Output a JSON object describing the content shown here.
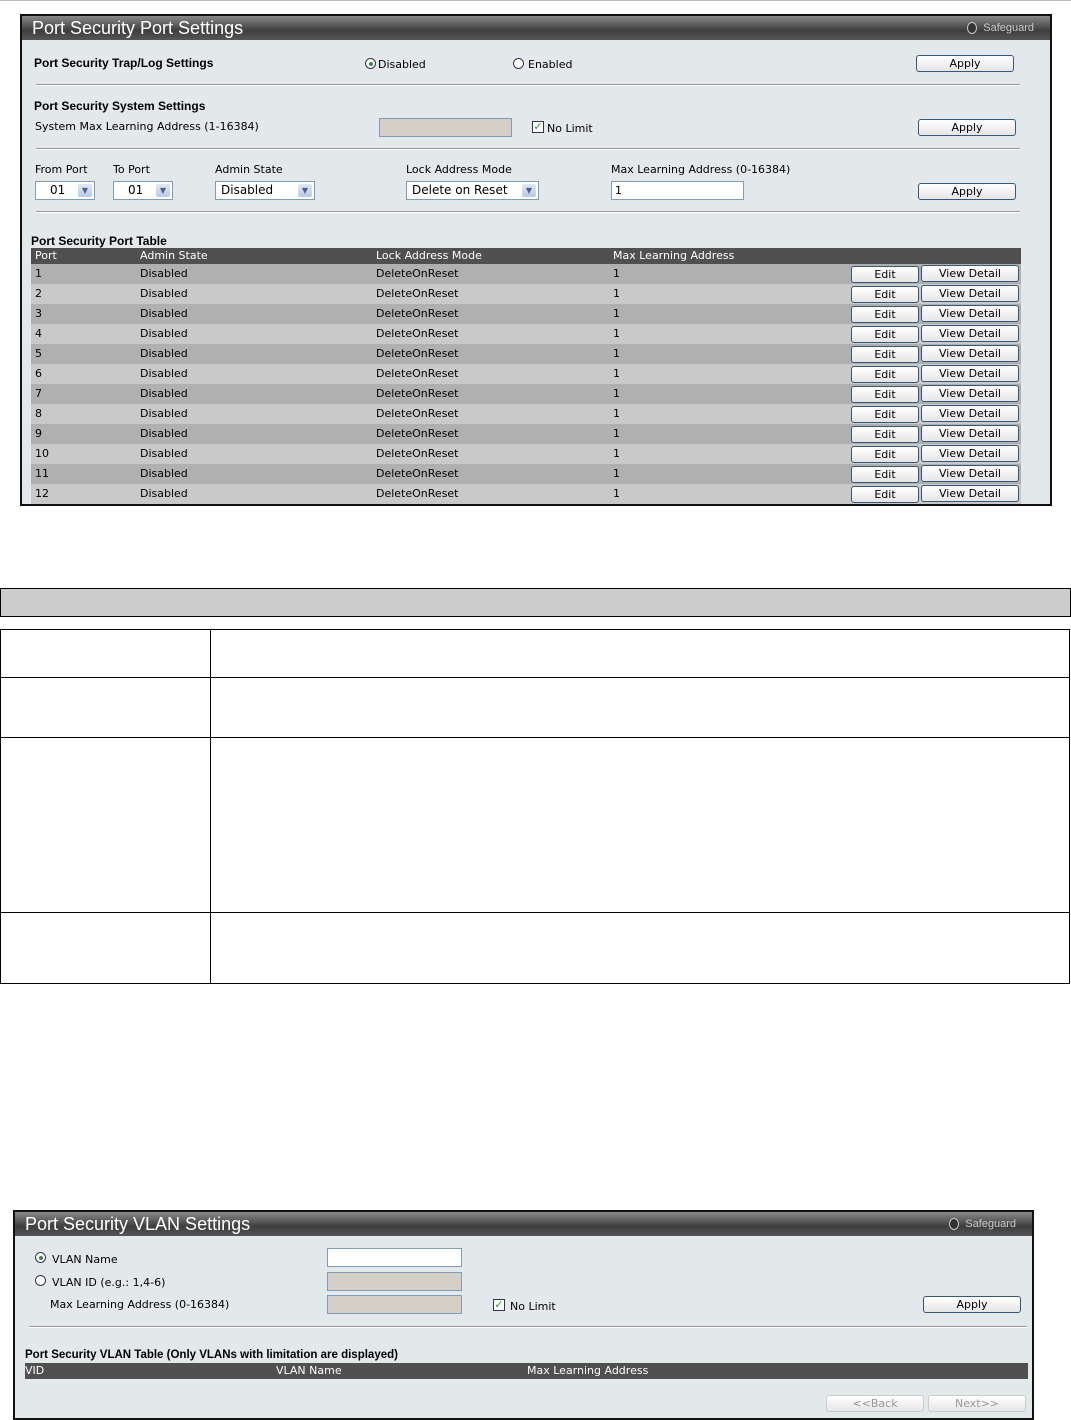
{
  "port_settings": {
    "title": "Port Security Port Settings",
    "safeguard": "Safeguard",
    "trap_log": {
      "label": "Port Security Trap/Log Settings",
      "disabled": "Disabled",
      "enabled": "Enabled",
      "selected": "Disabled",
      "apply": "Apply"
    },
    "system": {
      "heading": "Port Security System Settings",
      "label": "System Max Learning Address (1-16384)",
      "value": "",
      "no_limit": "No Limit",
      "no_limit_checked": true,
      "apply": "Apply"
    },
    "config": {
      "from_port_label": "From Port",
      "from_port": "01",
      "to_port_label": "To Port",
      "to_port": "01",
      "admin_state_label": "Admin State",
      "admin_state": "Disabled",
      "lock_mode_label": "Lock Address Mode",
      "lock_mode": "Delete on Reset",
      "max_label": "Max Learning Address (0-16384)",
      "max_value": "1",
      "apply": "Apply"
    },
    "table": {
      "title": "Port Security Port Table",
      "columns": [
        "Port",
        "Admin State",
        "Lock Address Mode",
        "Max Learning Address"
      ],
      "edit": "Edit",
      "view": "View Detail",
      "rows": [
        [
          "1",
          "Disabled",
          "DeleteOnReset",
          "1"
        ],
        [
          "2",
          "Disabled",
          "DeleteOnReset",
          "1"
        ],
        [
          "3",
          "Disabled",
          "DeleteOnReset",
          "1"
        ],
        [
          "4",
          "Disabled",
          "DeleteOnReset",
          "1"
        ],
        [
          "5",
          "Disabled",
          "DeleteOnReset",
          "1"
        ],
        [
          "6",
          "Disabled",
          "DeleteOnReset",
          "1"
        ],
        [
          "7",
          "Disabled",
          "DeleteOnReset",
          "1"
        ],
        [
          "8",
          "Disabled",
          "DeleteOnReset",
          "1"
        ],
        [
          "9",
          "Disabled",
          "DeleteOnReset",
          "1"
        ],
        [
          "10",
          "Disabled",
          "DeleteOnReset",
          "1"
        ],
        [
          "11",
          "Disabled",
          "DeleteOnReset",
          "1"
        ],
        [
          "12",
          "Disabled",
          "DeleteOnReset",
          "1"
        ]
      ]
    }
  },
  "vlan_settings": {
    "title": "Port Security VLAN Settings",
    "safeguard": "Safeguard",
    "vlan_name_label": "VLAN Name",
    "vlan_name_value": "",
    "vlan_id_label": "VLAN ID (e.g.: 1,4-6)",
    "max_label": "Max Learning Address (0-16384)",
    "no_limit": "No Limit",
    "apply": "Apply",
    "table_title": "Port Security VLAN Table (Only VLANs with limitation are displayed)",
    "columns": [
      "VID",
      "VLAN Name",
      "Max Learning Address"
    ],
    "back": "<<Back",
    "next": "Next>>"
  }
}
